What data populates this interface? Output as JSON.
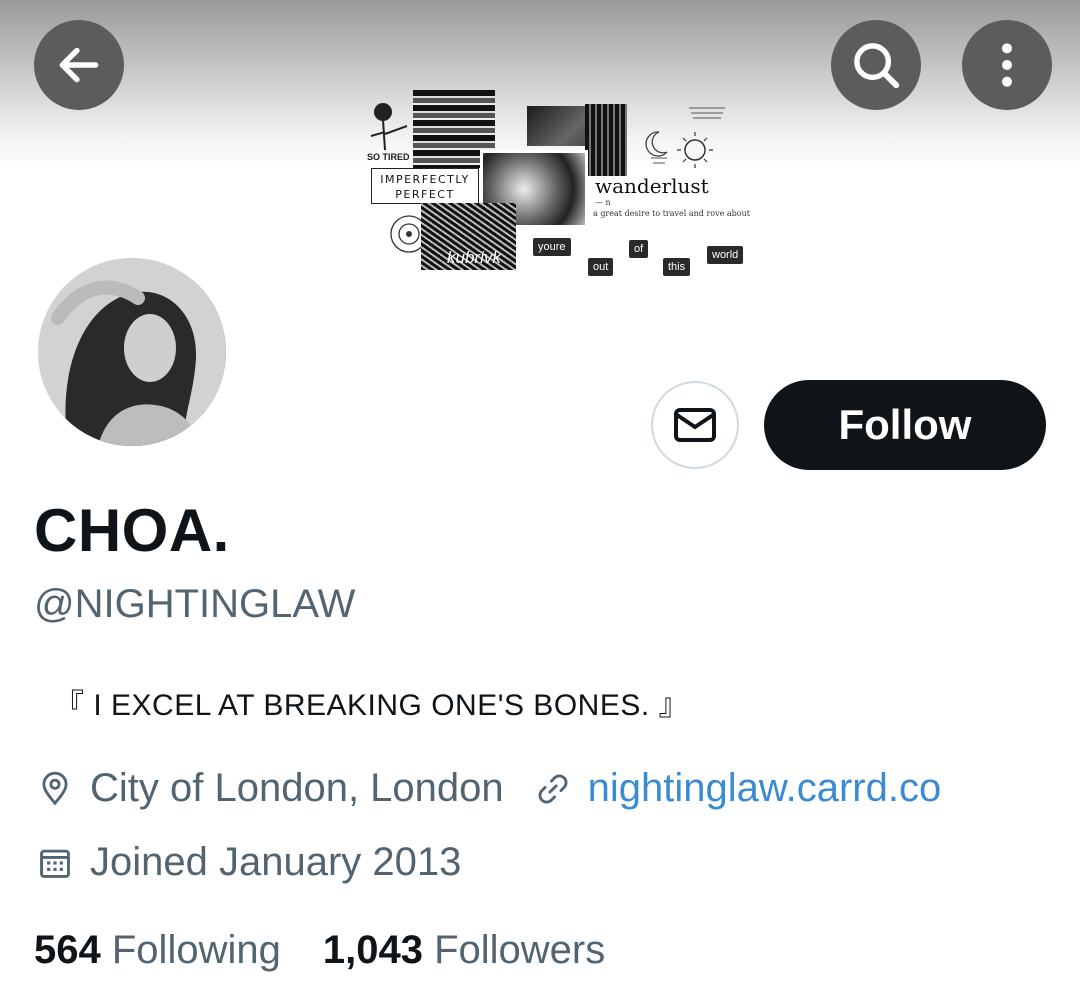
{
  "header": {
    "back_icon": "arrow-left-icon",
    "search_icon": "search-icon",
    "more_icon": "more-vertical-icon",
    "banner": {
      "so_tired": "SO TIRED",
      "imperfectly": "IMPERFECTLY",
      "perfect": "PERFECT",
      "wanderlust": "wanderlust",
      "wanderlust_pos": "— n",
      "wanderlust_def": "a great desire to travel and rove about",
      "kubrivk": "kubrivk",
      "tag_youre": "youre",
      "tag_out": "out",
      "tag_of": "of",
      "tag_this": "this",
      "tag_world": "world"
    }
  },
  "profile": {
    "name": "CHOA.",
    "handle": "@NIGHTINGLAW",
    "bio": "『 I EXCEL AT BREAKING ONE'S BONES. 』",
    "location": "City of London, London",
    "website": "nightinglaw.carrd.co",
    "joined": "Joined January 2013",
    "following_count": "564",
    "following_label": "Following",
    "followers_count": "1,043",
    "followers_label": "Followers"
  },
  "actions": {
    "message_icon": "mail-icon",
    "follow_label": "Follow"
  },
  "colors": {
    "primary_text": "#0f1419",
    "secondary_text": "#536471",
    "link": "#3a8bd1",
    "follow_bg": "#0f1419"
  }
}
